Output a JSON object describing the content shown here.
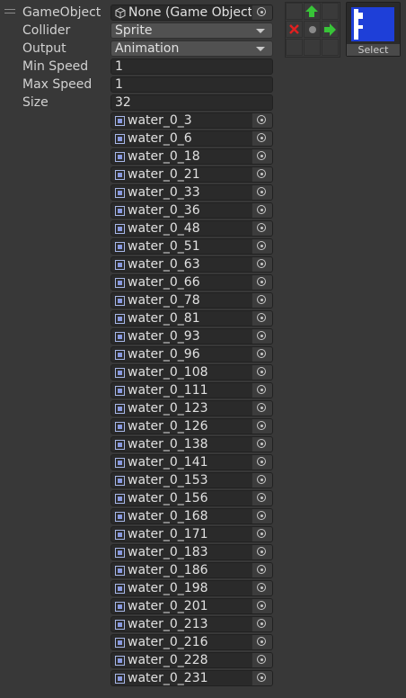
{
  "properties": {
    "gameobject": {
      "label": "GameObject",
      "value": "None (Game Object)"
    },
    "collider": {
      "label": "Collider",
      "value": "Sprite"
    },
    "output": {
      "label": "Output",
      "value": "Animation"
    },
    "min_speed": {
      "label": "Min Speed",
      "value": "1"
    },
    "max_speed": {
      "label": "Max Speed",
      "value": "1"
    },
    "size": {
      "label": "Size",
      "value": "32"
    }
  },
  "preview": {
    "select_label": "Select",
    "sprite_color": "#1e3fd8"
  },
  "anchor_colors": {
    "up_arrow": "#38c438",
    "right_arrow": "#38c438",
    "cross": "#e02020",
    "center_dot": "#8a8a8a"
  },
  "sprites": [
    "water_0_3",
    "water_0_6",
    "water_0_18",
    "water_0_21",
    "water_0_33",
    "water_0_36",
    "water_0_48",
    "water_0_51",
    "water_0_63",
    "water_0_66",
    "water_0_78",
    "water_0_81",
    "water_0_93",
    "water_0_96",
    "water_0_108",
    "water_0_111",
    "water_0_123",
    "water_0_126",
    "water_0_138",
    "water_0_141",
    "water_0_153",
    "water_0_156",
    "water_0_168",
    "water_0_171",
    "water_0_183",
    "water_0_186",
    "water_0_198",
    "water_0_201",
    "water_0_213",
    "water_0_216",
    "water_0_228",
    "water_0_231"
  ]
}
